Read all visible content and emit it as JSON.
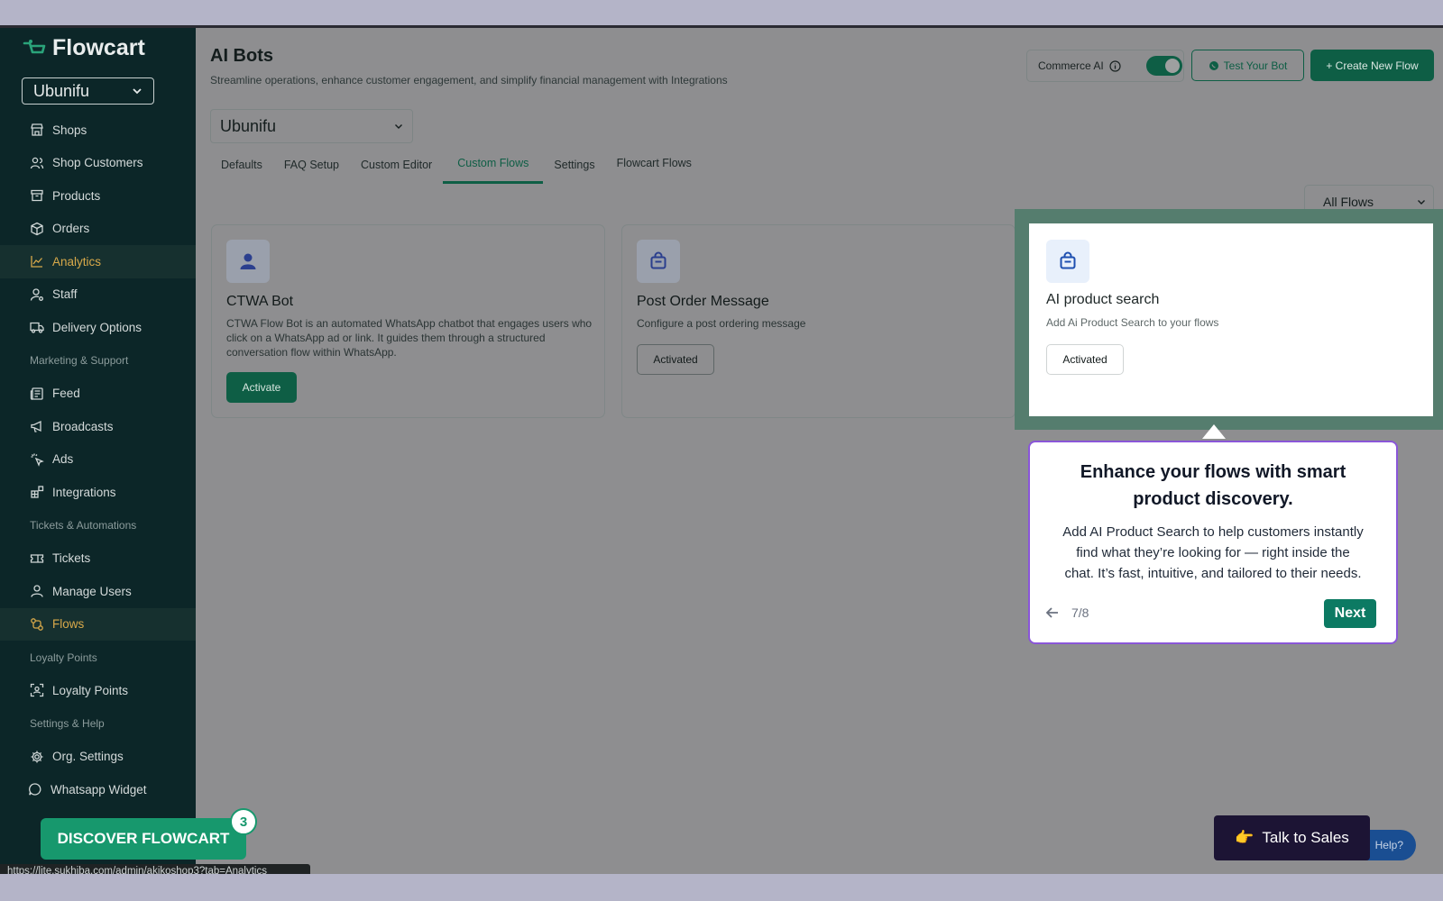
{
  "brand": {
    "name": "Flowcart",
    "org": "Ubunifu"
  },
  "sidebar": {
    "items": [
      {
        "label": "Shops",
        "icon": "store-icon"
      },
      {
        "label": "Shop Customers",
        "icon": "users-icon"
      },
      {
        "label": "Products",
        "icon": "archive-icon"
      },
      {
        "label": "Orders",
        "icon": "package-icon"
      },
      {
        "label": "Analytics",
        "icon": "chart-line-icon",
        "active": true
      },
      {
        "label": "Staff",
        "icon": "user-cog-icon"
      },
      {
        "label": "Delivery Options",
        "icon": "truck-icon"
      }
    ],
    "section_marketing": "Marketing & Support",
    "marketing": [
      {
        "label": "Feed",
        "icon": "newspaper-icon"
      },
      {
        "label": "Broadcasts",
        "icon": "megaphone-icon"
      },
      {
        "label": "Ads",
        "icon": "cursor-click-icon"
      },
      {
        "label": "Integrations",
        "icon": "blocks-icon"
      }
    ],
    "section_tickets": "Tickets & Automations",
    "tickets": [
      {
        "label": "Tickets",
        "icon": "ticket-icon"
      },
      {
        "label": "Manage Users",
        "icon": "user-icon"
      },
      {
        "label": "Flows",
        "icon": "flows-icon",
        "active": true
      }
    ],
    "section_loyalty": "Loyalty Points",
    "loyalty": [
      {
        "label": "Loyalty Points",
        "icon": "scan-icon"
      }
    ],
    "section_settings": "Settings & Help",
    "settings": [
      {
        "label": "Org. Settings",
        "icon": "gear-icon"
      },
      {
        "label": "Whatsapp Widget",
        "icon": "chat-icon"
      }
    ]
  },
  "header": {
    "title": "AI Bots",
    "subtitle": "Streamline operations, enhance customer engagement, and simplify financial management with Integrations",
    "commerce_ai_label": "Commerce AI",
    "test_bot_label": "Test Your Bot",
    "create_flow_label": "+ Create New Flow"
  },
  "shop_select": {
    "value": "Ubunifu"
  },
  "tabs": [
    {
      "label": "Defaults"
    },
    {
      "label": "FAQ Setup"
    },
    {
      "label": "Custom Editor"
    },
    {
      "label": "Custom Flows",
      "active": true
    },
    {
      "label": "Settings"
    },
    {
      "label": "Flowcart Flows"
    }
  ],
  "flows_filter": {
    "value": "All Flows"
  },
  "cards": [
    {
      "title": "CTWA Bot",
      "description_lines": [
        "CTWA Flow Bot is an automated WhatsApp chatbot that engages users who",
        "click on a WhatsApp ad or link. It guides them through a structured",
        "conversation flow within WhatsApp."
      ],
      "button": "Activate",
      "icon": "user-icon"
    },
    {
      "title": "Post Order Message",
      "description_lines": [
        "Configure a post ordering message"
      ],
      "button": "Activated",
      "icon": "bag-icon"
    },
    {
      "title": "AI product search",
      "description_lines": [
        "Add Ai Product Search to your flows"
      ],
      "button": "Activated",
      "icon": "bag-icon"
    }
  ],
  "tour": {
    "title_lines": [
      "Enhance your flows with smart",
      "product discovery."
    ],
    "body_lines": [
      "Add AI Product Search to help customers instantly",
      "find what they’re looking for — right inside the",
      "chat. It’s fast, intuitive, and tailored to their needs."
    ],
    "step": "7/8",
    "next_label": "Next"
  },
  "discover": {
    "label": "DISCOVER FLOWCART",
    "badge": "3"
  },
  "status_url": "https://lite.sukhiba.com/admin/akikoshop3?tab=Analytics",
  "help_label": "Help?",
  "sales": {
    "emoji": "👉",
    "label": "Talk to Sales"
  },
  "colors": {
    "accent": "#0e5e45",
    "sidebar_bg": "#0c2628",
    "active_nav": "#d8a94a",
    "tour_border": "#8a56d8"
  }
}
